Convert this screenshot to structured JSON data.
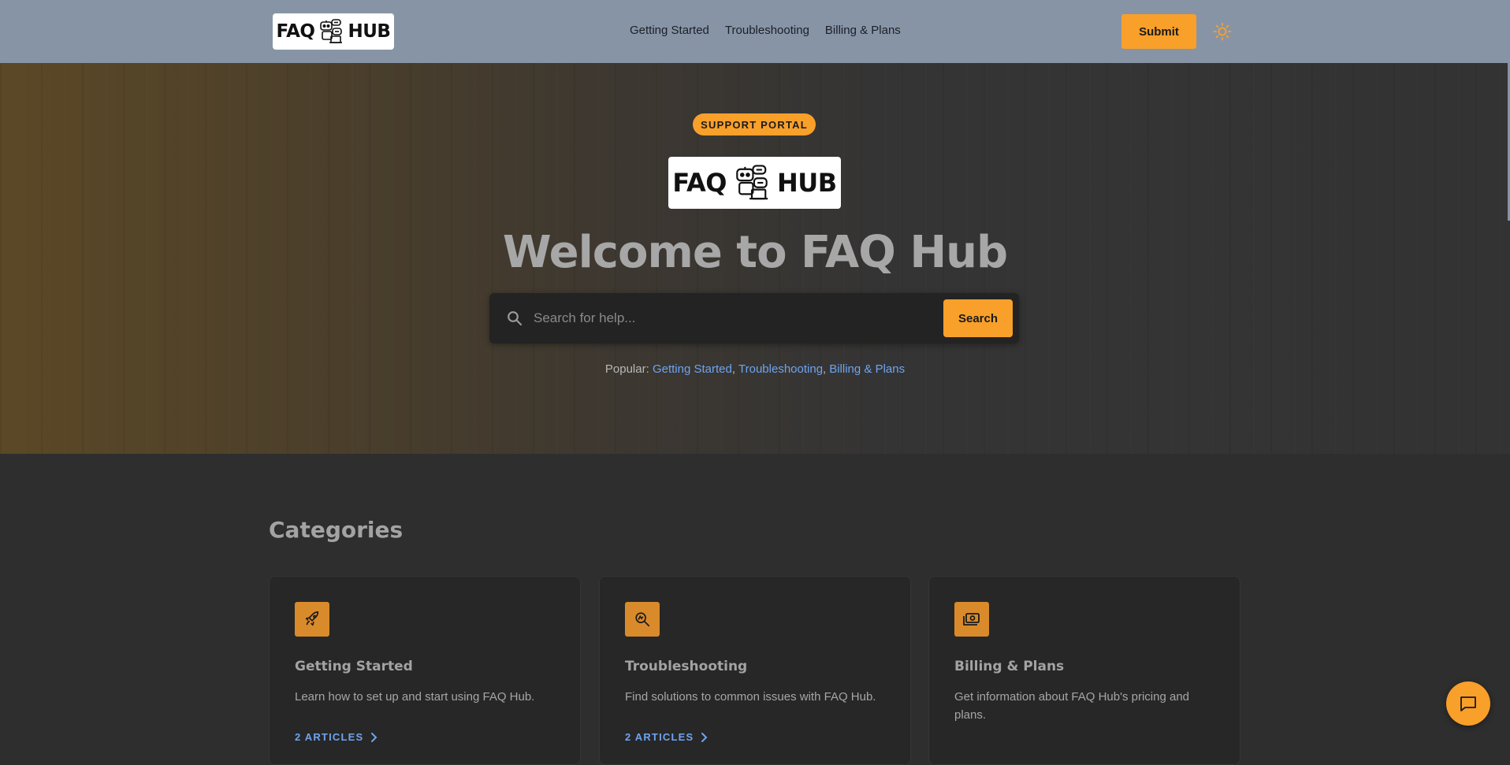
{
  "header": {
    "logo": {
      "left": "FAQ",
      "right": "HUB"
    },
    "nav": [
      "Getting Started",
      "Troubleshooting",
      "Billing & Plans"
    ],
    "submit_label": "Submit",
    "theme_icon": "sun-icon"
  },
  "hero": {
    "badge": "SUPPORT PORTAL",
    "logo": {
      "left": "FAQ",
      "right": "HUB"
    },
    "title": "Welcome to FAQ Hub",
    "search": {
      "placeholder": "Search for help...",
      "value": "",
      "button_label": "Search"
    },
    "popular_label": "Popular:",
    "popular_links": [
      "Getting Started",
      "Troubleshooting",
      "Billing & Plans"
    ]
  },
  "categories": {
    "title": "Categories",
    "cards": [
      {
        "icon": "rocket-icon",
        "title": "Getting Started",
        "description": "Learn how to set up and start using FAQ Hub.",
        "link": "2 ARTICLES"
      },
      {
        "icon": "magnify-wrench-icon",
        "title": "Troubleshooting",
        "description": "Find solutions to common issues with FAQ Hub.",
        "link": "2 ARTICLES"
      },
      {
        "icon": "money-icon",
        "title": "Billing & Plans",
        "description": "Get information about FAQ Hub's pricing and plans.",
        "link": ""
      }
    ]
  },
  "chat_icon": "chat-icon",
  "colors": {
    "accent": "#f9a02a",
    "header_bg": "#8794a6",
    "link": "#6ea4f0",
    "page_bg": "#2e2e2e"
  }
}
